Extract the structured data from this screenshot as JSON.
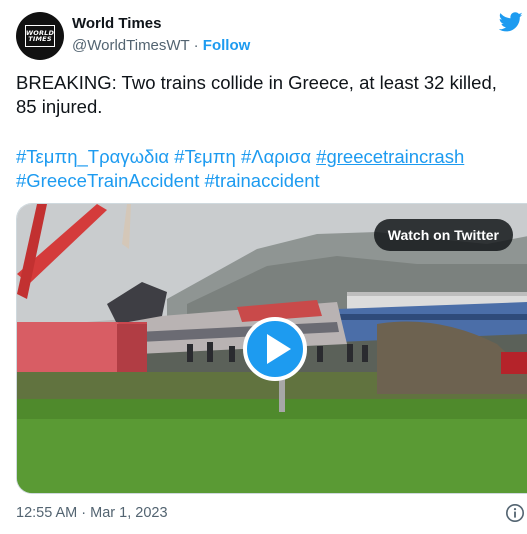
{
  "account": {
    "name": "World Times",
    "handle": "@WorldTimesWT",
    "separator": " · ",
    "follow_label": "Follow",
    "avatar_logo": {
      "line1": "WORLD",
      "line2": "TIMES"
    }
  },
  "tweet": {
    "text": "BREAKING: Two trains collide in Greece, at least 32 killed, 85 injured.",
    "hashtags": [
      "#Τεμπη_Τραγωδια",
      "#Τεμπη",
      "#Λαρισα",
      "#greecetraincrash",
      "#GreeceTrainAccident",
      "#trainaccident"
    ]
  },
  "media": {
    "watch_label": "Watch on Twitter",
    "play_icon": "play-icon"
  },
  "meta": {
    "time": "12:55 AM",
    "separator": " · ",
    "date": "Mar 1, 2023"
  },
  "icons": {
    "brand": "twitter-bird-icon",
    "info": "info-icon"
  },
  "colors": {
    "accent": "#1d9bf0",
    "text": "#0f1419",
    "secondary": "#536471"
  }
}
